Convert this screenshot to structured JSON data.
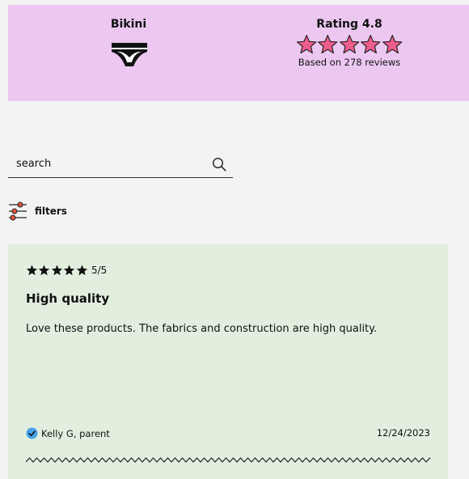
{
  "summary": {
    "product_name": "Bikini",
    "product_icon": "bikini-underwear-icon",
    "rating_title": "Rating 4.8",
    "rating_value": 4.8,
    "rating_stars": 5,
    "review_count_text": "Based on 278 reviews",
    "star_color": "#ef5d8d",
    "background_color": "#ecc8f1"
  },
  "search": {
    "placeholder": "search",
    "value": "",
    "icon": "search-icon"
  },
  "filters": {
    "label": "filters",
    "icon": "sliders-icon",
    "knob_color": "#e0553a"
  },
  "review": {
    "stars": 5,
    "score": "5/5",
    "title": "High quality",
    "body": "Love these products. The fabrics and construction are high quality.",
    "reviewer": "Kelly G, parent",
    "verified_icon": "verified-check-icon",
    "verified_color": "#4aa3e8",
    "date": "12/24/2023",
    "background_color": "#e2efdf"
  }
}
